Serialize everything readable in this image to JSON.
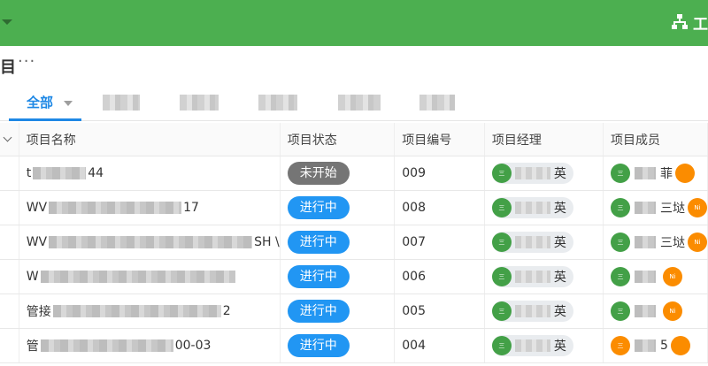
{
  "topbar": {
    "right_label": "工",
    "icon": "sitemap-icon"
  },
  "crumb": {
    "title": "目",
    "more": "···"
  },
  "tabs": {
    "active": "全部"
  },
  "table": {
    "columns": [
      "项目名称",
      "项目状态",
      "项目编号",
      "项目经理",
      "项目成员"
    ],
    "rows": [
      {
        "name_prefix": "t",
        "name_suffix": "44",
        "status": "未开始",
        "status_kind": "gray",
        "code": "009",
        "manager_suffix": "英",
        "member_text": "菲",
        "member_badge": ""
      },
      {
        "name_prefix": "WV",
        "name_suffix": "17",
        "status": "进行中",
        "status_kind": "blue",
        "code": "008",
        "manager_suffix": "英",
        "member_text": "三垯",
        "member_badge": "Ni"
      },
      {
        "name_prefix": "WV",
        "name_suffix": "SH \\",
        "status": "进行中",
        "status_kind": "blue",
        "code": "007",
        "manager_suffix": "英",
        "member_text": "三垯",
        "member_badge": "Ni"
      },
      {
        "name_prefix": "W",
        "name_suffix": "",
        "status": "进行中",
        "status_kind": "blue",
        "code": "006",
        "manager_suffix": "英",
        "member_text": "",
        "member_badge": "Ni"
      },
      {
        "name_prefix": "管接",
        "name_suffix": "2",
        "status": "进行中",
        "status_kind": "blue",
        "code": "005",
        "manager_suffix": "英",
        "member_text": "",
        "member_badge": "Ni"
      },
      {
        "name_prefix": "管",
        "name_suffix": "00-03",
        "status": "进行中",
        "status_kind": "blue",
        "code": "004",
        "manager_suffix": "英",
        "member_text": "5",
        "member_badge": ""
      }
    ]
  },
  "colors": {
    "topbar": "#4caf50",
    "accent": "#1e88e5",
    "status_blue": "#2196f3",
    "status_gray": "#757575"
  }
}
